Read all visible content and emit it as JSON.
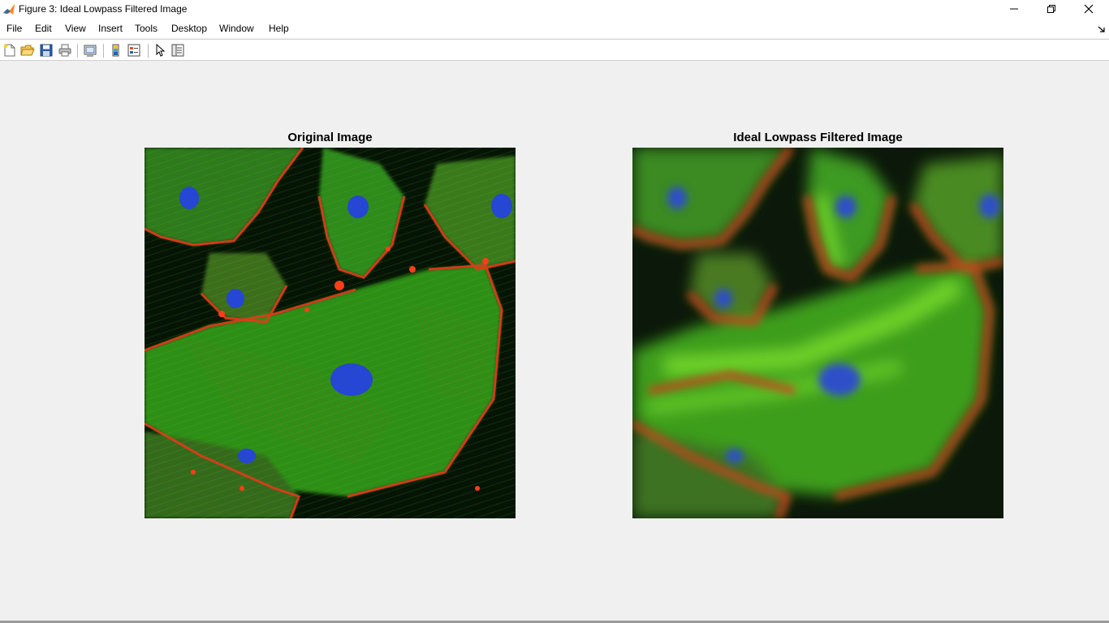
{
  "window": {
    "title": "Figure 3: Ideal Lowpass Filtered Image",
    "app_icon": "matlab-icon",
    "controls": [
      "minimize-icon",
      "restore-icon",
      "close-icon"
    ]
  },
  "menubar": {
    "items": [
      "File",
      "Edit",
      "View",
      "Insert",
      "Tools",
      "Desktop",
      "Window",
      "Help"
    ]
  },
  "toolbar": {
    "buttons": [
      "new-figure-icon",
      "open-file-icon",
      "save-icon",
      "print-icon",
      "link-plot-icon",
      "insert-colorbar-icon",
      "insert-legend-icon",
      "edit-plot-icon",
      "property-inspector-icon"
    ]
  },
  "axes": [
    {
      "title": "Original Image",
      "content": "fluorescence-cell-image"
    },
    {
      "title": "Ideal Lowpass Filtered Image",
      "content": "blurred-fluorescence-cell-image"
    }
  ]
}
